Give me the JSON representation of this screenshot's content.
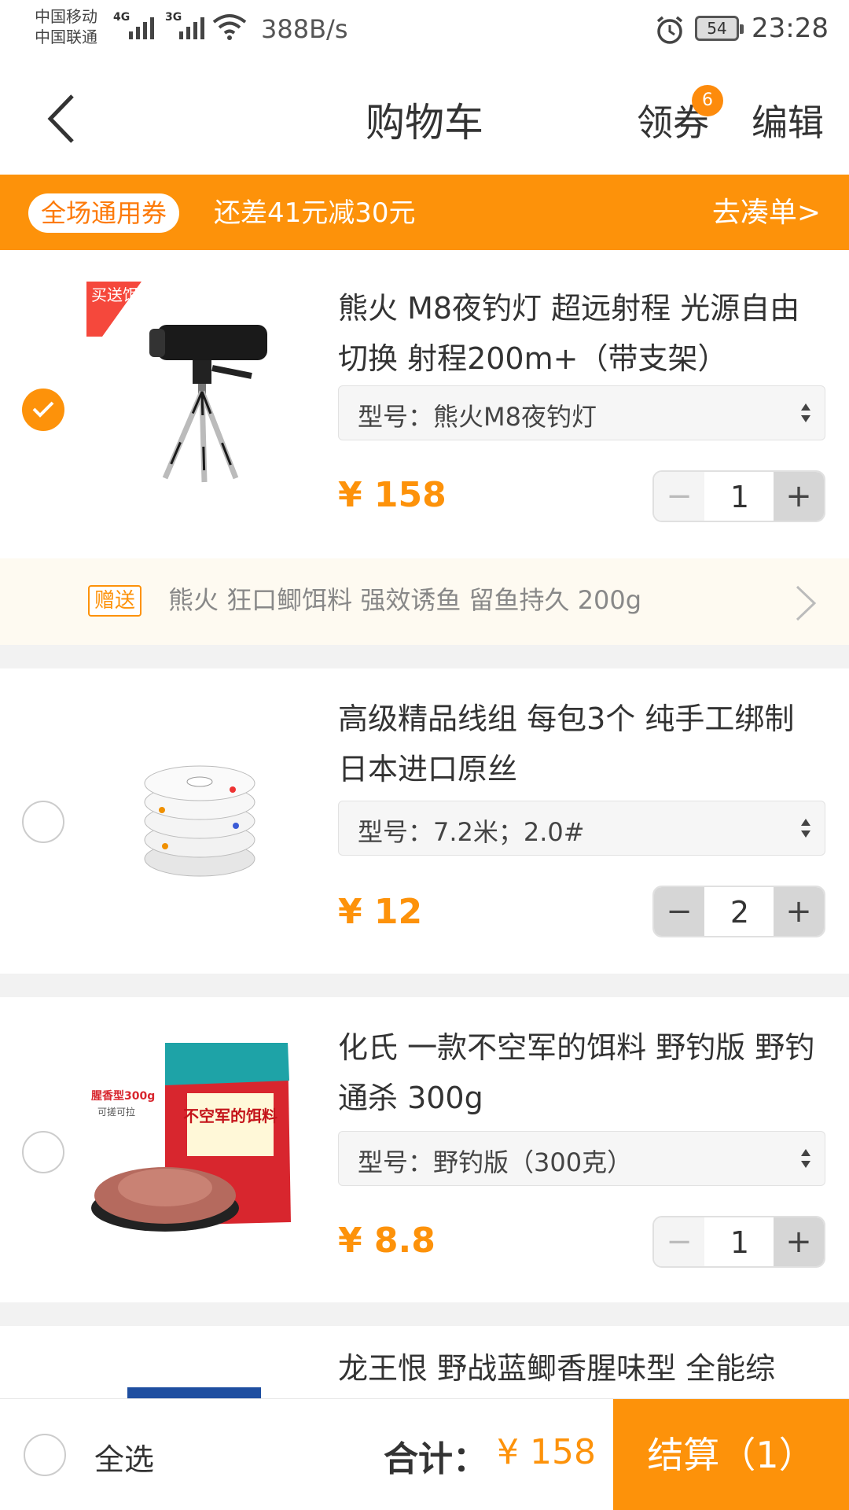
{
  "status_bar": {
    "carrier1": "中国移动",
    "carrier2": "中国联通",
    "net1": "4G",
    "net2": "3G",
    "speed": "388B/s",
    "battery": "54",
    "time": "23:28"
  },
  "nav": {
    "title": "购物车",
    "coupon_label": "领券",
    "coupon_badge": "6",
    "edit_label": "编辑"
  },
  "promo": {
    "tag": "全场通用券",
    "text": "还差41元减30元",
    "action": "去凑单>"
  },
  "items": [
    {
      "name": "熊火 M8夜钓灯 超远射程 光源自由切换  射程200m+（带支架）",
      "spec": "型号：熊火M8夜钓灯",
      "price": "¥ 158",
      "qty": "1",
      "checked": true,
      "thumb_badge": "买送饵料"
    },
    {
      "name": "高级精品线组 每包3个 纯手工绑制  日本进口原丝",
      "spec": "型号：7.2米；2.0#",
      "price": "¥ 12",
      "qty": "2",
      "checked": false
    },
    {
      "name": "化氏 一款不空军的饵料 野钓版 野钓通杀 300g",
      "spec": "型号：野钓版（300克）",
      "price": "¥ 8.8",
      "qty": "1",
      "checked": false,
      "thumb_text": "不空军的饵料",
      "thumb_side": "腥香型300g",
      "thumb_side2": "可搓可拉"
    },
    {
      "name": "龙王恨 野战蓝鲫香腥味型 全能综"
    }
  ],
  "gift": {
    "tag": "赠送",
    "text": "熊火 狂口鲫饵料 强效诱鱼 留鱼持久 200g"
  },
  "bottom": {
    "select_all": "全选",
    "total_label": "合计：",
    "total_value": "¥ 158",
    "checkout": "结算（1）"
  },
  "colors": {
    "accent": "#fd920a"
  }
}
